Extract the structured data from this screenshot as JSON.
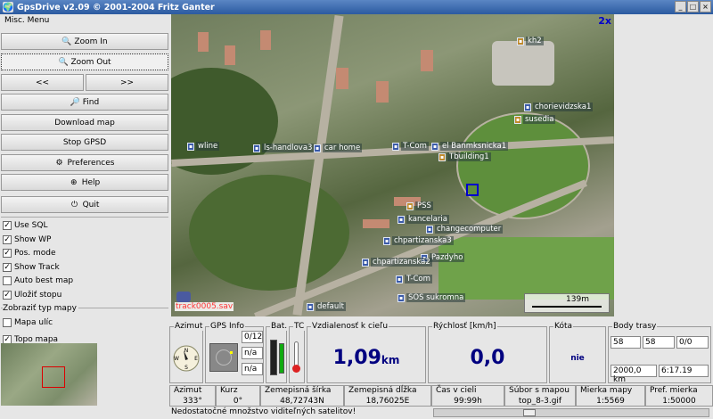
{
  "window": {
    "title": "GpsDrive v2.09  © 2001-2004 Fritz Ganter",
    "buttons": [
      "_",
      "□",
      "×"
    ]
  },
  "sidebar": {
    "menu": "Misc. Menu",
    "buttons": {
      "zoom_in": "Zoom In",
      "zoom_out": "Zoom Out",
      "prev": "<<",
      "next": ">>",
      "find": "Find",
      "download_map": "Download map",
      "stop_gpsd": "Stop GPSD",
      "preferences": "Preferences",
      "help": "Help",
      "quit": "Quit"
    },
    "checks": [
      {
        "label": "Use SQL",
        "checked": true
      },
      {
        "label": "Show WP",
        "checked": true
      },
      {
        "label": "Pos. mode",
        "checked": true
      },
      {
        "label": "Show Track",
        "checked": true
      },
      {
        "label": "Auto best map",
        "checked": false
      },
      {
        "label": "Uložiť stopu",
        "checked": true
      }
    ],
    "maptype_group": "Zobraziť typ mapy",
    "maptype_options": [
      {
        "label": "Mapa ulíc",
        "checked": false
      },
      {
        "label": "Topo mapa",
        "checked": true
      }
    ]
  },
  "map": {
    "zoom": "2x",
    "scale": "139m",
    "track_file": "track0005.sav",
    "pois": [
      "kh2",
      "chorievidzska1",
      "susedia",
      "wline",
      "ls-handlova3",
      "car home",
      "T-Com",
      "el Banmksnicka1",
      "Tbuilding1",
      "PSS",
      "kancelaria",
      "changecomputer",
      "chpartizanska3",
      "Pazdyho",
      "chpartizanska2",
      "T-Com",
      "SOS sukromna",
      "default"
    ]
  },
  "panel": {
    "azimut_label": "Azimut",
    "azimut_value": "333°",
    "gpsinfo_label": "GPS Info",
    "gpsinfo_values": [
      "0/12",
      "n/a",
      "n/a"
    ],
    "bat_label": "Bat.",
    "tc_label": "TC",
    "distance_label": "Vzdialenosť k cieľu",
    "distance_value": "1,09",
    "distance_unit": "km",
    "speed_label": "Rýchlosť [km/h]",
    "speed_value": "0,0",
    "altitude_label": "Kóta",
    "altitude_value": "nie",
    "trackpoints_label": "Body trasy",
    "trackpoints_values": [
      "58",
      "58",
      "0/0"
    ],
    "track_length": "2000,0 km",
    "track_time": "6:17.19"
  },
  "status": {
    "azimut": {
      "label": "Azimut",
      "value": "333°"
    },
    "course": {
      "label": "Kurz",
      "value": "0°"
    },
    "lat": {
      "label": "Zemepisná šírka",
      "value": "48,72743N"
    },
    "lon": {
      "label": "Zemepisná dĺžka",
      "value": "18,76025E"
    },
    "eta": {
      "label": "Čas v cieli",
      "value": "99:99h"
    },
    "mapfile": {
      "label": "Súbor s mapou",
      "value": "top_8-3.gif"
    },
    "mapscale": {
      "label": "Mierka mapy",
      "value": "1:5569"
    },
    "prefscale": {
      "label": "Pref. mierka",
      "value": "1:50000"
    },
    "message": "Nedostatočné množstvo viditeľných satelitov!"
  }
}
